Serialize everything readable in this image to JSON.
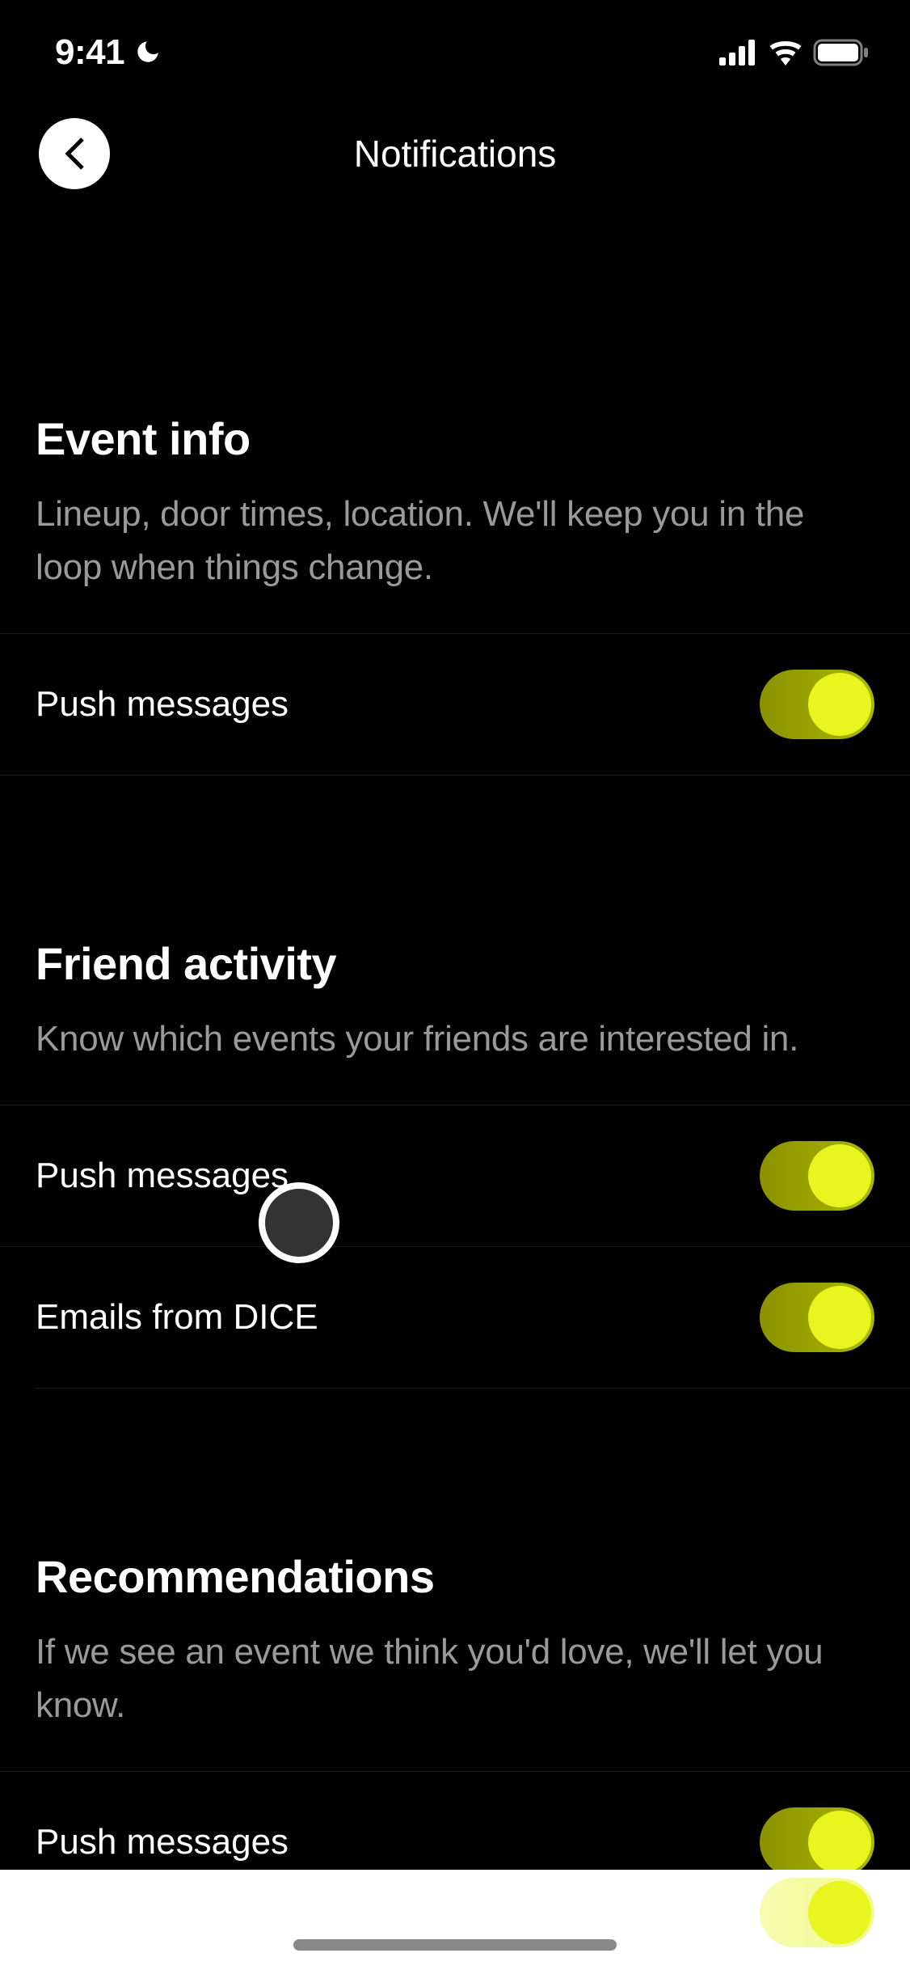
{
  "statusBar": {
    "time": "9:41"
  },
  "header": {
    "title": "Notifications"
  },
  "sections": [
    {
      "title": "Event info",
      "description": "Lineup, door times, location. We'll keep you in the loop when things change.",
      "settings": [
        {
          "label": "Push messages",
          "enabled": true
        }
      ]
    },
    {
      "title": "Friend activity",
      "description": "Know which events your friends are interested in.",
      "settings": [
        {
          "label": "Push messages",
          "enabled": true
        },
        {
          "label": "Emails from DICE",
          "enabled": true
        }
      ]
    },
    {
      "title": "Recommendations",
      "description": "If we see an event we think you'd love, we'll let you know.",
      "settings": [
        {
          "label": "Push messages",
          "enabled": true
        }
      ]
    }
  ]
}
